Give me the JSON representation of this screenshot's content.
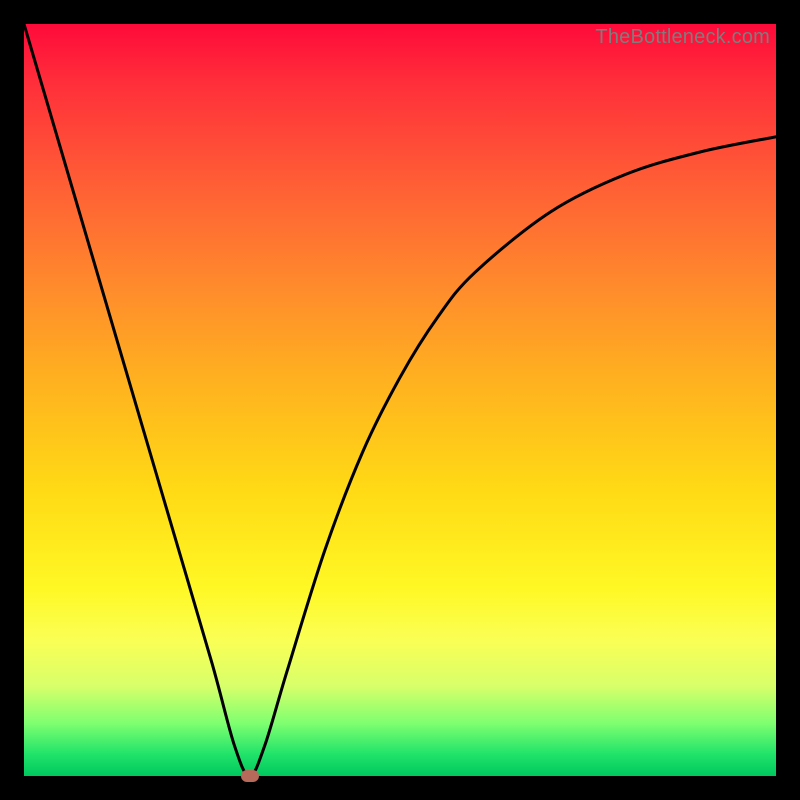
{
  "watermark": "TheBottleneck.com",
  "colors": {
    "background": "#000000",
    "curve_stroke": "#000000",
    "marker_fill": "#b76a5a",
    "watermark_text": "#7d7d7d"
  },
  "chart_data": {
    "type": "line",
    "title": "",
    "xlabel": "",
    "ylabel": "",
    "xlim": [
      0,
      100
    ],
    "ylim": [
      0,
      100
    ],
    "series": [
      {
        "name": "curve",
        "x": [
          0,
          5,
          10,
          15,
          20,
          25,
          28,
          30,
          32,
          35,
          40,
          45,
          50,
          55,
          60,
          70,
          80,
          90,
          100
        ],
        "values": [
          100,
          83,
          66,
          49,
          32,
          15,
          4,
          0,
          4,
          14,
          30,
          43,
          53,
          61,
          67,
          75,
          80,
          83,
          85
        ]
      }
    ],
    "minimum_marker": {
      "x": 30,
      "y": 0
    },
    "gradient_stops": [
      {
        "pct": 0,
        "color": "#ff0a3a"
      },
      {
        "pct": 8,
        "color": "#ff2f3a"
      },
      {
        "pct": 20,
        "color": "#ff5a36"
      },
      {
        "pct": 35,
        "color": "#ff8b2c"
      },
      {
        "pct": 48,
        "color": "#ffb31f"
      },
      {
        "pct": 62,
        "color": "#ffda15"
      },
      {
        "pct": 75,
        "color": "#fff825"
      },
      {
        "pct": 82,
        "color": "#faff55"
      },
      {
        "pct": 88,
        "color": "#d8ff6a"
      },
      {
        "pct": 93,
        "color": "#7eff70"
      },
      {
        "pct": 97,
        "color": "#22e46a"
      },
      {
        "pct": 100,
        "color": "#00c85e"
      }
    ]
  }
}
